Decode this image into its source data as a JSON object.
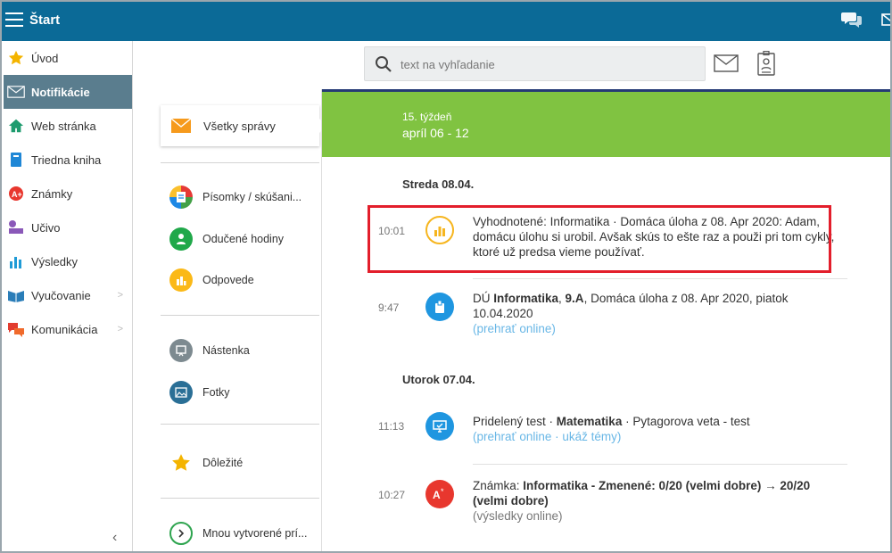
{
  "header": {
    "title": "Štart"
  },
  "colors": {
    "topbar": "#0b6a97",
    "accent_green": "#80c341",
    "active_sidebar": "#5a7d8e",
    "link": "#69b7e6",
    "highlight": "#e31e2b"
  },
  "sidebar": {
    "items": [
      {
        "label": "Úvod",
        "icon": "star-icon"
      },
      {
        "label": "Notifikácie",
        "icon": "envelope-icon"
      },
      {
        "label": "Web stránka",
        "icon": "home-icon"
      },
      {
        "label": "Triedna kniha",
        "icon": "book-icon"
      },
      {
        "label": "Známky",
        "icon": "grade-icon"
      },
      {
        "label": "Učivo",
        "icon": "lesson-icon"
      },
      {
        "label": "Výsledky",
        "icon": "chart-icon"
      },
      {
        "label": "Vyučovanie",
        "icon": "teaching-icon"
      },
      {
        "label": "Komunikácia",
        "icon": "chat-icon"
      }
    ],
    "collapse": "‹"
  },
  "search": {
    "placeholder": "text na vyhľadanie"
  },
  "categories": {
    "all": "Všetky správy",
    "items": [
      {
        "label": "Písomky / skúšani..."
      },
      {
        "label": "Odučené hodiny"
      },
      {
        "label": "Odpovede"
      },
      {
        "label": "Nástenka"
      },
      {
        "label": "Fotky"
      },
      {
        "label": "Dôležité"
      },
      {
        "label": "Mnou vytvorené prí..."
      }
    ]
  },
  "main": {
    "week_label": "15. týždeň",
    "week_range": "apríl 06 - 12",
    "days": [
      {
        "date": "Streda 08.04.",
        "messages": [
          {
            "time": "10:01",
            "text": "Vyhodnotené: Informatika · Domáca úloha z 08. Apr 2020: Adam, domácu úlohu si urobil. Avšak skús to ešte raz a použi pri tom cykly, ktoré už predsa vieme používať."
          },
          {
            "time": "9:47",
            "prefix": "DÚ ",
            "subject": "Informatika",
            "sep": ", ",
            "cls": "9.A",
            "rest": ", Domáca úloha z 08. Apr 2020, piatok 10.04.2020",
            "link": "(prehrať online)"
          }
        ]
      },
      {
        "date": "Utorok 07.04.",
        "messages": [
          {
            "time": "11:13",
            "prefix": "Pridelený test · ",
            "subject": "Matematika",
            "rest": " · Pytagorova veta - test",
            "link": "(prehrať online · ukáž témy)"
          },
          {
            "time": "10:27",
            "prefix": "Známka: ",
            "subject": "Informatika - Zmenené: 0/20 (velmi dobre) → 20/20 (velmi dobre)",
            "link": "(výsledky online)"
          }
        ]
      }
    ]
  }
}
